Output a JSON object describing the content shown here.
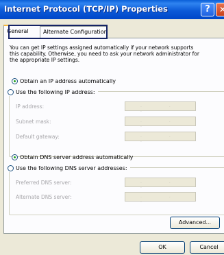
{
  "window": {
    "title": "Internet Protocol (TCP/IP) Properties",
    "help_label": "?",
    "close_label": "✕"
  },
  "tabs": [
    {
      "label": "General",
      "active": true
    },
    {
      "label": "Alternate Configuration",
      "active": false
    }
  ],
  "description": "You can get IP settings assigned automatically if your network supports\nthis capability. Otherwise, you need to ask your network administrator for\nthe appropriate IP settings.",
  "ip": {
    "auto_label": "Obtain an IP address automatically",
    "auto_selected": true,
    "manual_label": "Use the following IP address:",
    "fields": [
      {
        "label": "IP address:",
        "value": ""
      },
      {
        "label": "Subnet mask:",
        "value": ""
      },
      {
        "label": "Default gateway:",
        "value": ""
      }
    ]
  },
  "dns": {
    "auto_label": "Obtain DNS server address automatically",
    "auto_selected": true,
    "manual_label": "Use the following DNS server addresses:",
    "fields": [
      {
        "label": "Preferred DNS server:",
        "value": ""
      },
      {
        "label": "Alternate DNS server:",
        "value": ""
      }
    ]
  },
  "buttons": {
    "advanced": "Advanced...",
    "ok": "OK",
    "cancel": "Cancel"
  },
  "colors": {
    "titlebar": "#0c5ad8",
    "highlight_border": "#162466",
    "radio_dot": "#21a121"
  }
}
